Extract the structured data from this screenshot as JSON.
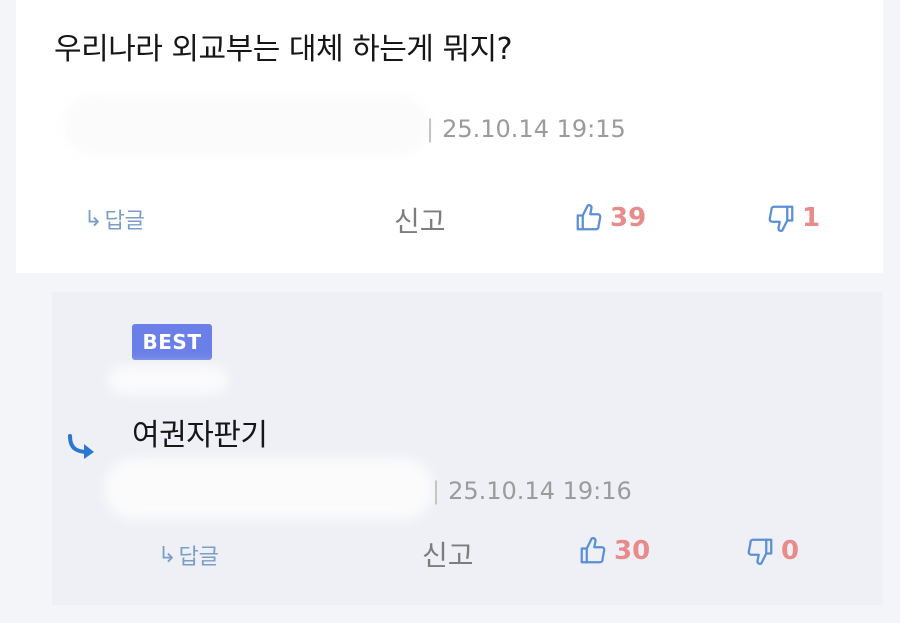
{
  "comment": {
    "text": "우리나라 외교부는 대체 하는게 뭐지?",
    "timestamp": "25.10.14 19:15",
    "reply_label": "답글",
    "report_label": "신고",
    "upvotes": "39",
    "downvotes": "1"
  },
  "reply": {
    "badge": "BEST",
    "text": "여권자판기",
    "timestamp": "25.10.14 19:16",
    "reply_label": "답글",
    "report_label": "신고",
    "upvotes": "30",
    "downvotes": "0"
  },
  "colors": {
    "thumb_icon": "#5b8fd6",
    "vote_count": "#e98b8b",
    "badge": "#6b7fe8",
    "reply_arrow": "#2a78d2"
  },
  "icons": {
    "reply": "corner-down-right-arrow-icon",
    "upvote": "thumbs-up-icon",
    "downvote": "thumbs-down-icon"
  }
}
